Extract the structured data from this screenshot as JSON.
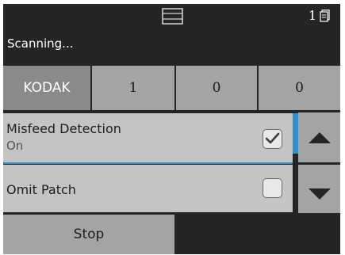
{
  "header": {
    "page_count": "1",
    "status": "Scanning..."
  },
  "counters": {
    "brand": "KODAK",
    "values": [
      "1",
      "0",
      "0"
    ]
  },
  "options": [
    {
      "label": "Misfeed Detection",
      "value": "On",
      "checked": true
    },
    {
      "label": "Omit Patch",
      "value": "",
      "checked": false
    }
  ],
  "footer": {
    "stop_label": "Stop"
  },
  "icons": {
    "scanner": "scanner-icon",
    "pages": "page-stack-icon",
    "scroll_up": "chevron-up-icon",
    "scroll_down": "chevron-down-icon",
    "check": "check-icon"
  },
  "colors": {
    "background": "#252525",
    "tile": "#a4a4a4",
    "brand_tile": "#8a8a8a",
    "list_row": "#c4c4c4",
    "accent": "#2f8fd0"
  }
}
